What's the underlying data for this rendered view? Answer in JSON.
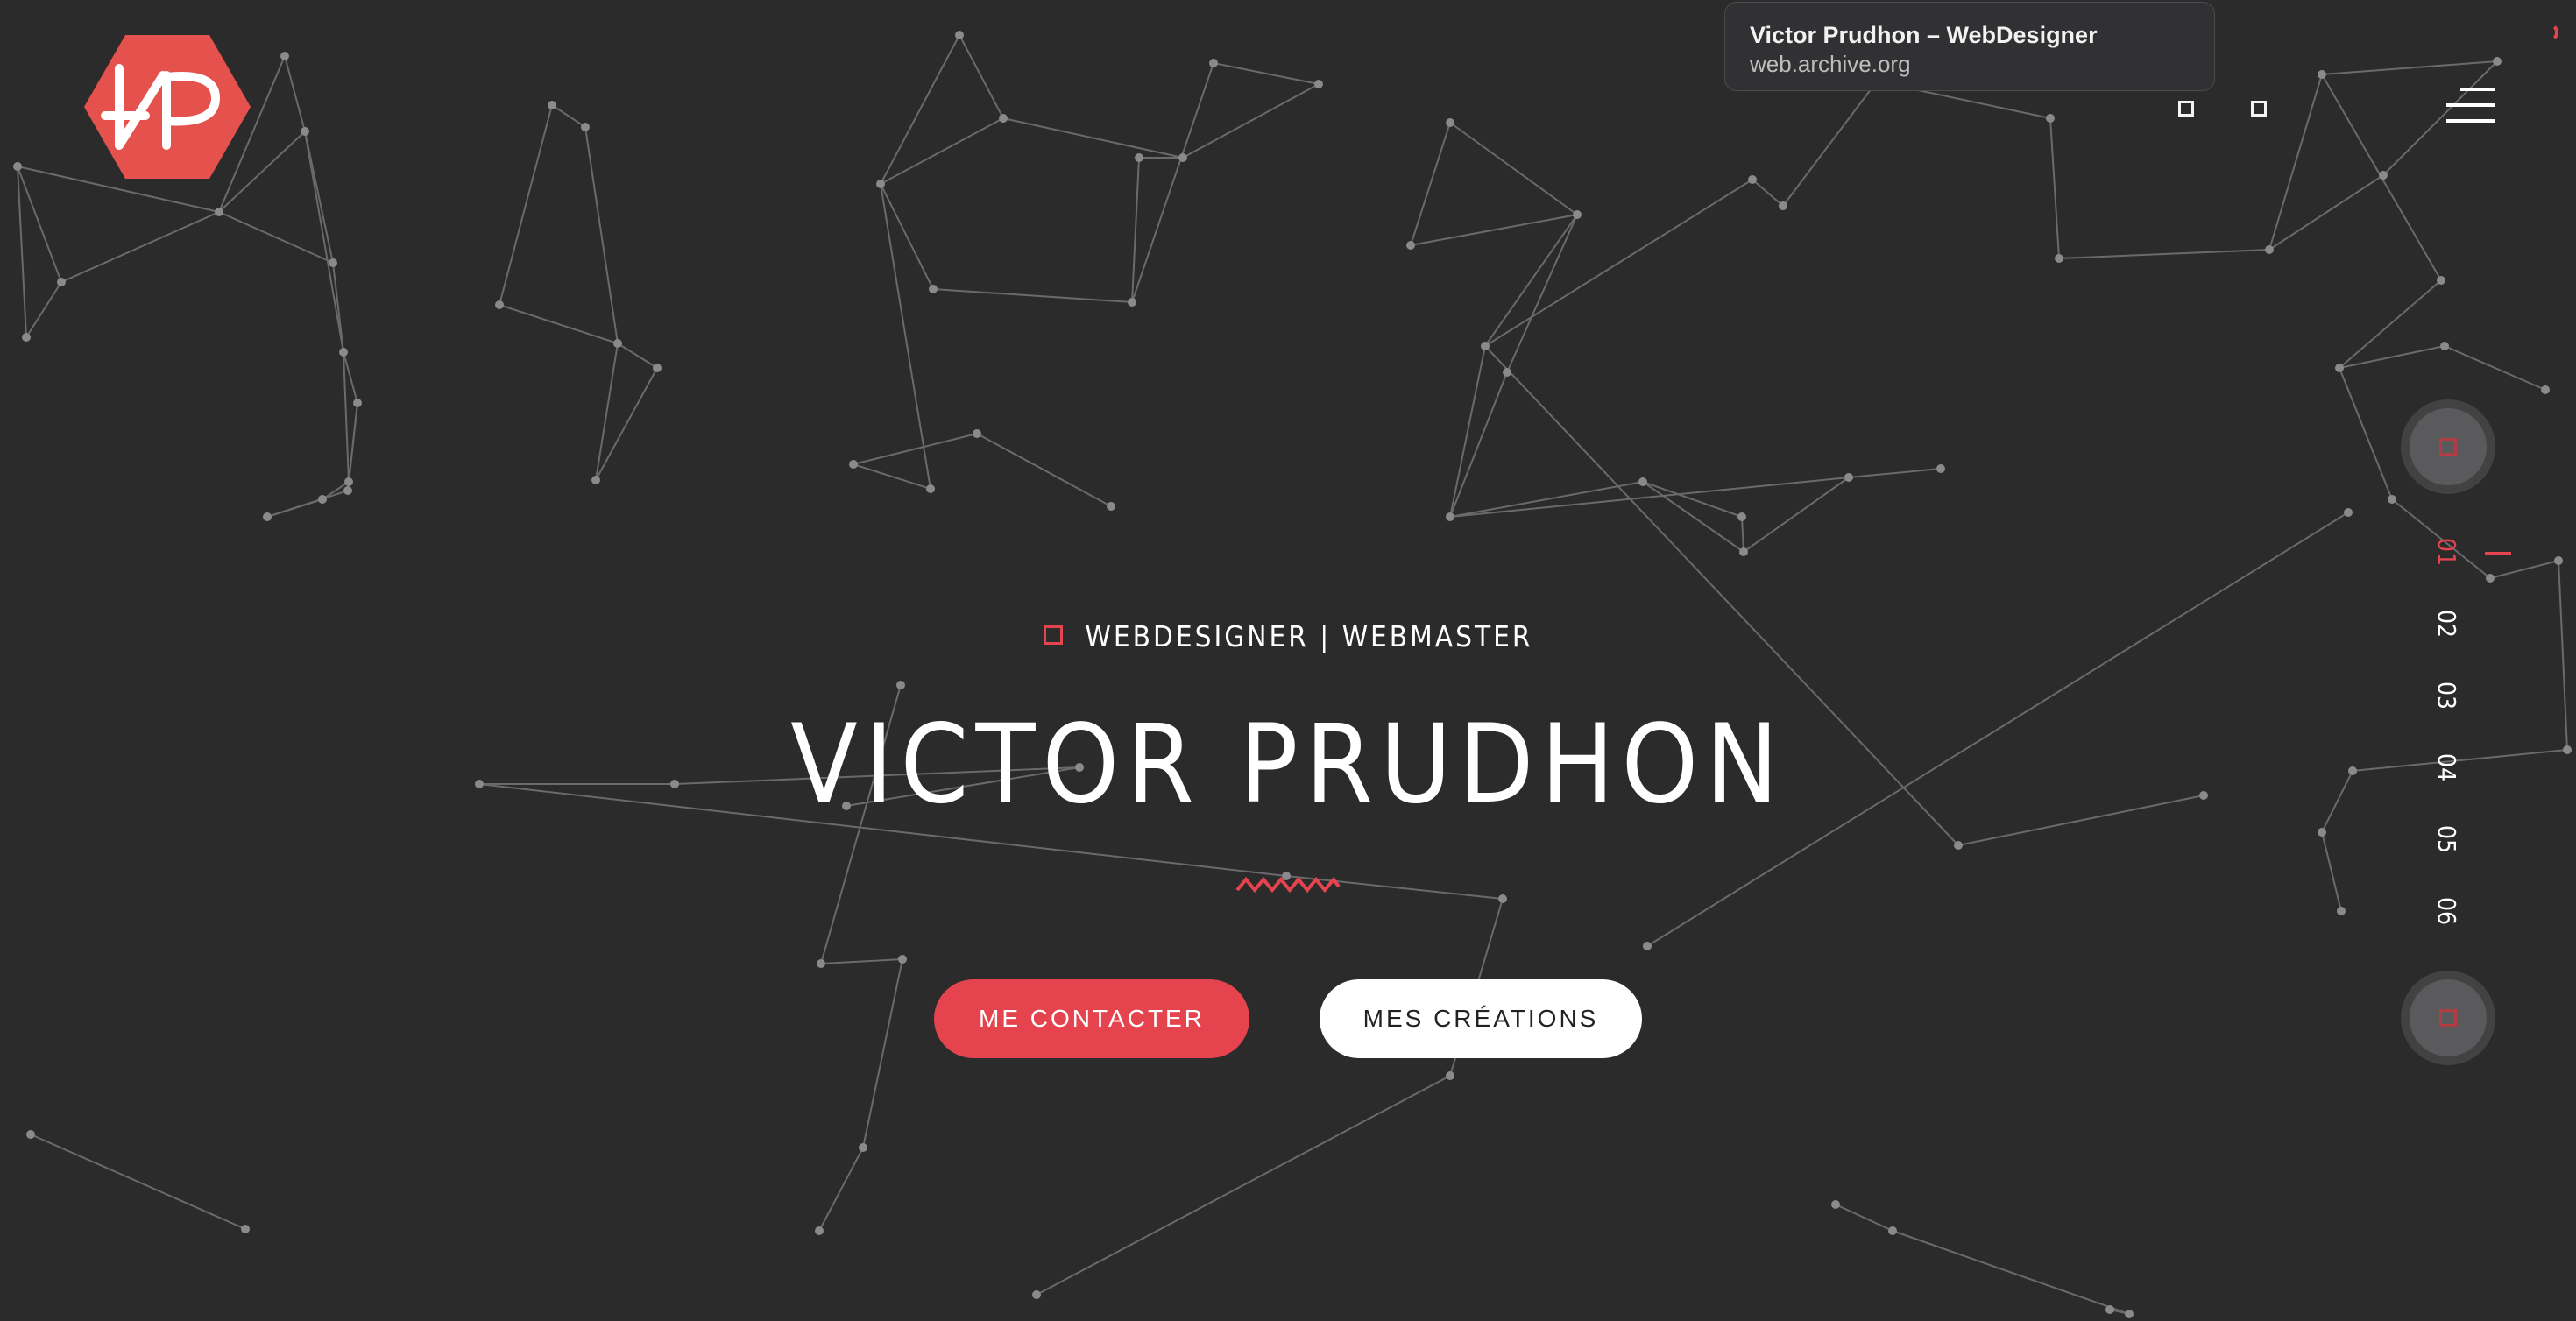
{
  "tooltip": {
    "title": "Victor Prudhon – WebDesigner",
    "url": "web.archive.org"
  },
  "hero": {
    "subtitle": "WEBDESIGNER | WEBMASTER",
    "title": "VICTOR PRUDHON",
    "contact_label": "ME CONTACTER",
    "creations_label": "MES CRÉATIONS"
  },
  "sections": [
    "01",
    "02",
    "03",
    "04",
    "05",
    "06"
  ],
  "colors": {
    "background": "#2b2b2c",
    "accent": "#e5444f",
    "network_line": "#6a6a6c",
    "network_node": "#8a8a8c"
  },
  "icons": {
    "logo": "vp-hexagon-logo",
    "menu": "hamburger-icon",
    "scroll_up": "scroll-up-icon",
    "scroll_down": "scroll-down-icon"
  }
}
